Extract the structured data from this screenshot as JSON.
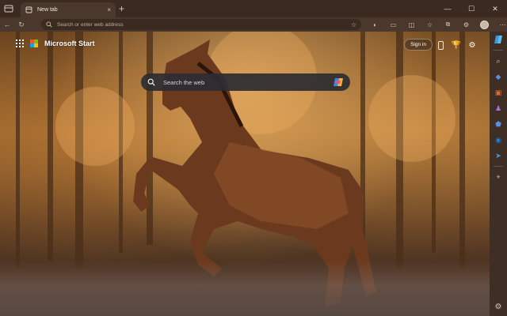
{
  "browser": {
    "tab": {
      "title": "New tab",
      "close_glyph": "×"
    },
    "new_tab_glyph": "+",
    "window_controls": {
      "minimize": "—",
      "maximize": "☐",
      "close": "✕"
    },
    "address_bar": {
      "placeholder": "Search or enter web address",
      "value": ""
    },
    "nav": {
      "back": "←",
      "refresh": "↻"
    }
  },
  "page": {
    "brand": "Microsoft Start",
    "sign_in_label": "Sign in",
    "search_placeholder": "Search the web"
  },
  "sidebar": {
    "items": [
      "search-icon",
      "tag-icon",
      "briefcase-icon",
      "games-icon",
      "shield-icon",
      "outlook-icon",
      "send-icon",
      "add-icon",
      "settings-icon"
    ]
  },
  "colors": {
    "chrome_dark": "#3a2a20",
    "chrome_mid": "#4a382c",
    "search_bg": "#2d2d32",
    "accent_blue": "#3a9be0"
  }
}
